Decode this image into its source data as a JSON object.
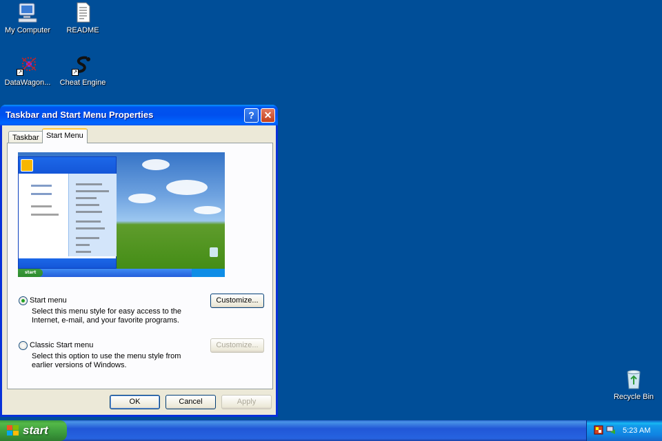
{
  "desktop": {
    "icons": [
      {
        "label": "My Computer",
        "icon": "computer-icon"
      },
      {
        "label": "README",
        "icon": "text-file-icon"
      },
      {
        "label": "DataWagon...",
        "icon": "datawagon-icon"
      },
      {
        "label": "Cheat Engine",
        "icon": "cheat-engine-icon"
      },
      {
        "label": "Recycle Bin",
        "icon": "recycle-bin-icon"
      }
    ]
  },
  "dialog": {
    "title": "Taskbar and Start Menu Properties",
    "help": "?",
    "close": "✕",
    "tabs": [
      {
        "label": "Taskbar"
      },
      {
        "label": "Start Menu",
        "selected": true
      }
    ],
    "options": [
      {
        "label": "Start menu",
        "checked": true,
        "description": "Select this menu style for easy access to the Internet, e-mail, and your favorite programs.",
        "button": "Customize..."
      },
      {
        "label": "Classic Start menu",
        "checked": false,
        "description": "Select this option to use the menu style from earlier versions of Windows.",
        "button": "Customize..."
      }
    ],
    "buttons": {
      "ok": "OK",
      "cancel": "Cancel",
      "apply": "Apply"
    }
  },
  "taskbar": {
    "start_label": "start",
    "clock": "5:23 AM"
  },
  "colors": {
    "desktop": "#004e98",
    "titlebar": "#0053ee",
    "start_green": "#3c9b3c"
  }
}
